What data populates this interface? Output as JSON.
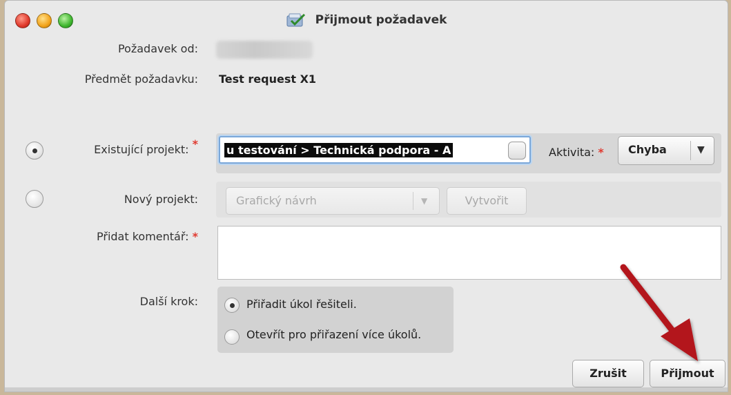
{
  "window": {
    "title": "Přijmout požadavek"
  },
  "fields": {
    "from_label": "Požadavek od:",
    "subject_label": "Předmět požadavku:",
    "subject_value": "Test request X1",
    "existing_project_label": "Existující projekt:",
    "existing_project_value": "u testování > Technická podpora - A",
    "activity_label": "Aktivita:",
    "activity_value": "Chyba",
    "new_project_label": "Nový projekt:",
    "new_project_value": "Grafický návrh",
    "create_label": "Vytvořit",
    "comment_label": "Přidat komentář:",
    "comment_value": "",
    "next_step_label": "Další krok:"
  },
  "required_mark": "*",
  "next_step_options": [
    {
      "label": "Přiřadit úkol řešiteli.",
      "selected": true
    },
    {
      "label": "Otevřít pro přiřazení více úkolů.",
      "selected": false
    }
  ],
  "buttons": {
    "cancel": "Zrušit",
    "accept": "Přijmout"
  },
  "icons": {
    "close": "close-icon",
    "minimize": "minimize-icon",
    "maximize": "maximize-icon",
    "title": "accept-request-icon",
    "dropdown": "chevron-down-icon",
    "annotation": "red-arrow-icon"
  },
  "colors": {
    "required": "#e03a30",
    "focus": "#7aa7d9",
    "annotation_arrow": "#b3141c"
  }
}
